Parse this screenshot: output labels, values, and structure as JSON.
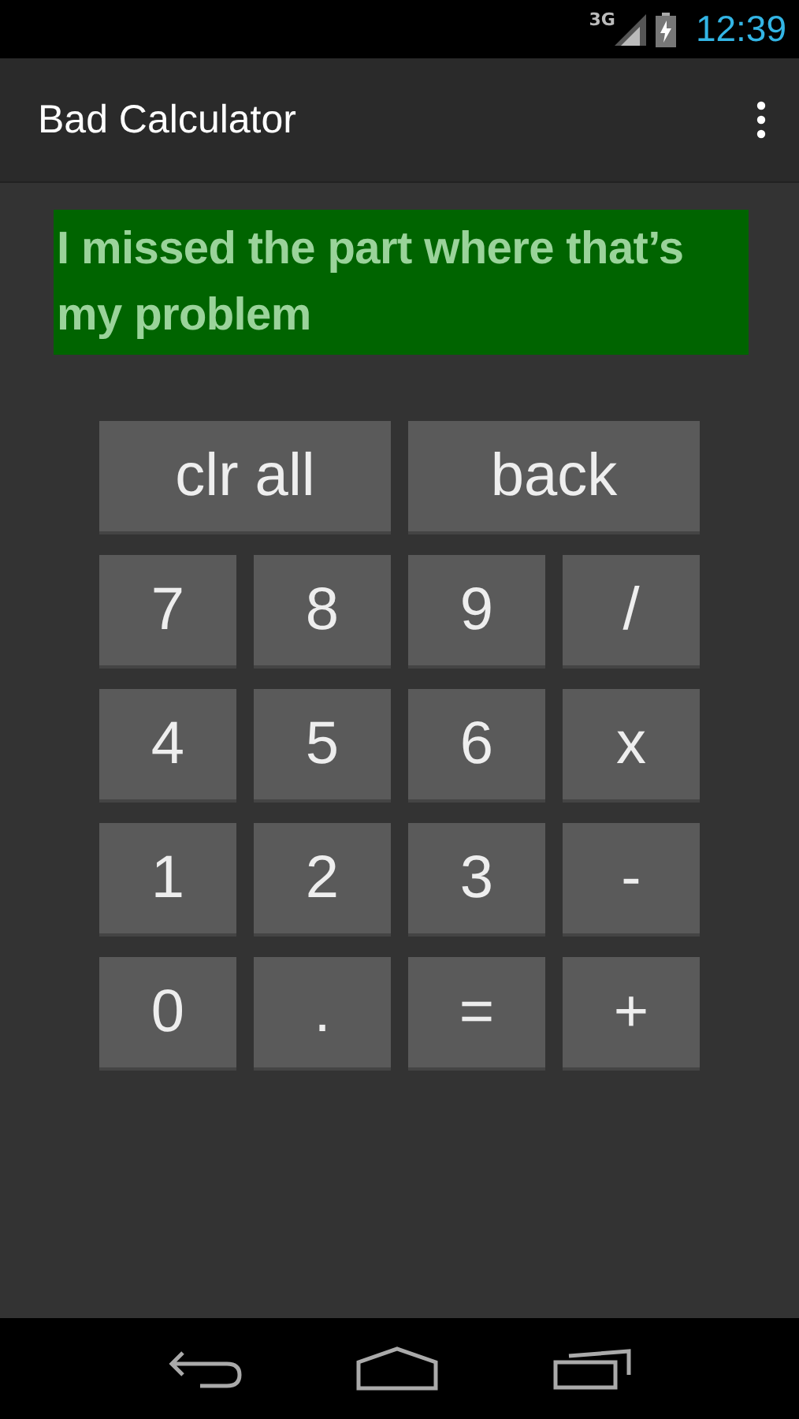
{
  "status_bar": {
    "network": "3G",
    "time": "12:39"
  },
  "action_bar": {
    "title": "Bad Calculator"
  },
  "display": {
    "text": "I missed the part where that’s my problem"
  },
  "keys": [
    {
      "label": "clr all",
      "kind": "wide"
    },
    {
      "label": "back",
      "kind": "wide"
    },
    {
      "label": "7",
      "kind": "key"
    },
    {
      "label": "8",
      "kind": "key"
    },
    {
      "label": "9",
      "kind": "key"
    },
    {
      "label": "/",
      "kind": "key"
    },
    {
      "label": "4",
      "kind": "key"
    },
    {
      "label": "5",
      "kind": "key"
    },
    {
      "label": "6",
      "kind": "key"
    },
    {
      "label": "x",
      "kind": "key"
    },
    {
      "label": "1",
      "kind": "key"
    },
    {
      "label": "2",
      "kind": "key"
    },
    {
      "label": "3",
      "kind": "key"
    },
    {
      "label": "-",
      "kind": "key"
    },
    {
      "label": "0",
      "kind": "key"
    },
    {
      "label": ".",
      "kind": "key"
    },
    {
      "label": "=",
      "kind": "key"
    },
    {
      "label": "+",
      "kind": "key"
    }
  ]
}
